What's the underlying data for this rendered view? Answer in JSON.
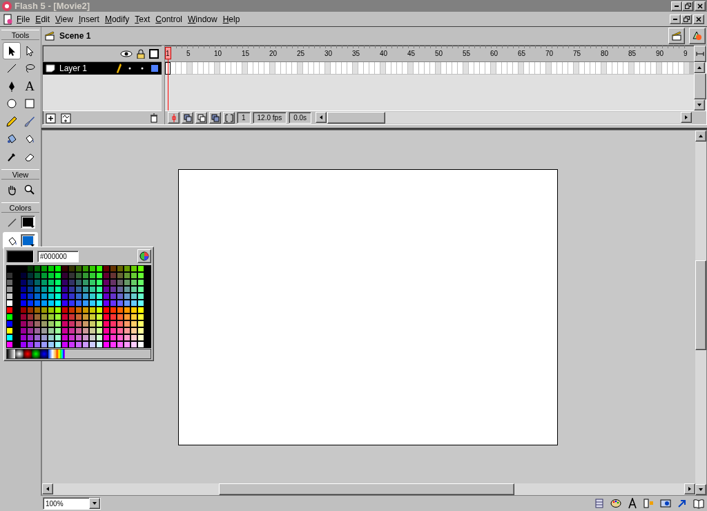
{
  "window": {
    "title": "Flash 5 - [Movie2]"
  },
  "menu": [
    {
      "label": "File"
    },
    {
      "label": "Edit"
    },
    {
      "label": "View"
    },
    {
      "label": "Insert"
    },
    {
      "label": "Modify"
    },
    {
      "label": "Text"
    },
    {
      "label": "Control"
    },
    {
      "label": "Window"
    },
    {
      "label": "Help"
    }
  ],
  "tools": {
    "title": "Tools",
    "items": [
      {
        "kind": "arrow",
        "selected": true
      },
      {
        "kind": "subselect",
        "selected": false
      },
      {
        "kind": "line",
        "selected": false
      },
      {
        "kind": "lasso",
        "selected": false
      },
      {
        "kind": "pen",
        "selected": false
      },
      {
        "kind": "text",
        "selected": false,
        "glyph": "A"
      },
      {
        "kind": "oval",
        "selected": false
      },
      {
        "kind": "rectangle",
        "selected": false
      },
      {
        "kind": "pencil",
        "selected": false
      },
      {
        "kind": "brush",
        "selected": false
      },
      {
        "kind": "ink",
        "selected": false
      },
      {
        "kind": "bucket",
        "selected": false
      },
      {
        "kind": "dropper",
        "selected": false
      },
      {
        "kind": "eraser",
        "selected": false
      }
    ]
  },
  "view_tools": {
    "title": "View",
    "items": [
      {
        "kind": "hand",
        "selected": false
      },
      {
        "kind": "zoom",
        "selected": false
      }
    ]
  },
  "colors": {
    "title": "Colors",
    "swatches": [
      {
        "kind": "stroke",
        "color": "#000000",
        "selected": false
      },
      {
        "kind": "fill",
        "color": "#0066cc",
        "selected": true
      }
    ]
  },
  "color_popup": {
    "hex": "#000000"
  },
  "scene": {
    "title": "Scene 1"
  },
  "timeline": {
    "layers": [
      {
        "name": "Layer 1",
        "selected": true
      }
    ],
    "ruler": [
      {
        "label": "1"
      },
      {
        "label": "5"
      },
      {
        "label": "10"
      },
      {
        "label": "15"
      },
      {
        "label": "20"
      },
      {
        "label": "25"
      },
      {
        "label": "30"
      },
      {
        "label": "35"
      },
      {
        "label": "40"
      },
      {
        "label": "45"
      },
      {
        "label": "50"
      },
      {
        "label": "55"
      },
      {
        "label": "60"
      },
      {
        "label": "65"
      },
      {
        "label": "70"
      },
      {
        "label": "75"
      },
      {
        "label": "80"
      },
      {
        "label": "85"
      },
      {
        "label": "90"
      },
      {
        "label": "9"
      }
    ],
    "current_frame": "1",
    "frame_rate": "12.0 fps",
    "elapsed": "0.0s"
  },
  "status_bar": {
    "zoom": "100%"
  }
}
